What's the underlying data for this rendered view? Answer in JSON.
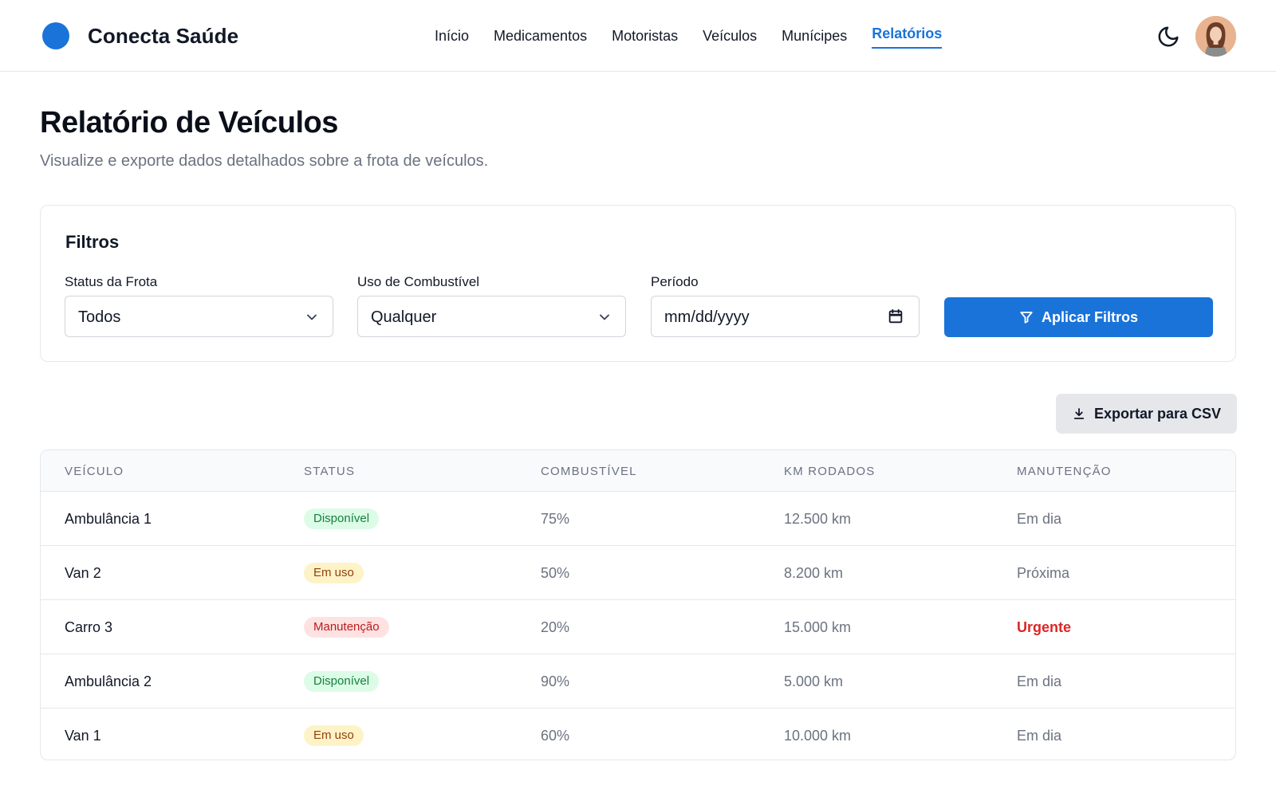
{
  "app": {
    "name": "Conecta Saúde",
    "brand_color": "#1a73d9"
  },
  "nav": {
    "items": [
      {
        "label": "Início",
        "active": false
      },
      {
        "label": "Medicamentos",
        "active": false
      },
      {
        "label": "Motoristas",
        "active": false
      },
      {
        "label": "Veículos",
        "active": false
      },
      {
        "label": "Munícipes",
        "active": false
      },
      {
        "label": "Relatórios",
        "active": true
      }
    ],
    "theme_toggle_icon": "moon-icon",
    "avatar_icon": "user-avatar"
  },
  "page": {
    "title": "Relatório de Veículos",
    "subtitle": "Visualize e exporte dados detalhados sobre a frota de veículos."
  },
  "filters": {
    "title": "Filtros",
    "status": {
      "label": "Status da Frota",
      "value": "Todos"
    },
    "fuel": {
      "label": "Uso de Combustível",
      "value": "Qualquer"
    },
    "period": {
      "label": "Período",
      "placeholder": "mm/dd/yyyy"
    },
    "apply_label": "Aplicar Filtros",
    "apply_icon": "filter-icon"
  },
  "export": {
    "label": "Exportar para CSV",
    "icon": "download-icon"
  },
  "table": {
    "headers": [
      "Veículo",
      "Status",
      "Combustível",
      "KM Rodados",
      "Manutenção"
    ],
    "rows": [
      {
        "vehicle": "Ambulância 1",
        "status": "Disponível",
        "status_tone": "green",
        "fuel": "75%",
        "km": "12.500 km",
        "maintenance": "Em dia",
        "maintenance_tone": "muted"
      },
      {
        "vehicle": "Van 2",
        "status": "Em uso",
        "status_tone": "yellow",
        "fuel": "50%",
        "km": "8.200 km",
        "maintenance": "Próxima",
        "maintenance_tone": "muted"
      },
      {
        "vehicle": "Carro 3",
        "status": "Manutenção",
        "status_tone": "red",
        "fuel": "20%",
        "km": "15.000 km",
        "maintenance": "Urgente",
        "maintenance_tone": "urgent"
      },
      {
        "vehicle": "Ambulância 2",
        "status": "Disponível",
        "status_tone": "green",
        "fuel": "90%",
        "km": "5.000 km",
        "maintenance": "Em dia",
        "maintenance_tone": "muted"
      },
      {
        "vehicle": "Van 1",
        "status": "Em uso",
        "status_tone": "yellow",
        "fuel": "60%",
        "km": "10.000 km",
        "maintenance": "Em dia",
        "maintenance_tone": "muted"
      }
    ],
    "status_colors": {
      "green": "#dcfce7",
      "yellow": "#fef3c7",
      "red": "#fee2e2"
    },
    "urgent_color": "#dc2626"
  }
}
